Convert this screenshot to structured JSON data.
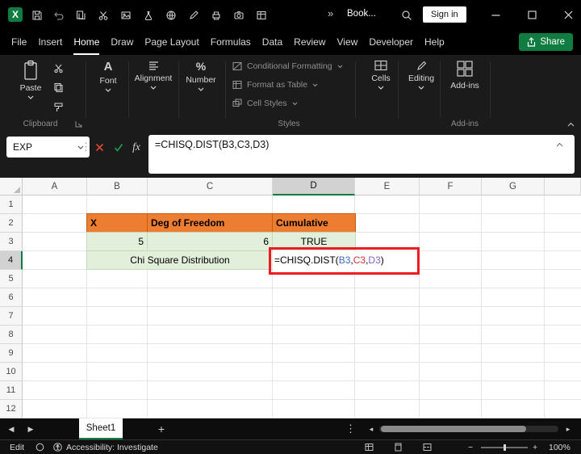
{
  "colors": {
    "excel_green": "#107C41",
    "titlebar_bg": "#000000",
    "ribbon_bg": "#1b1b1b",
    "orange_fill": "#ED7D31",
    "green_fill": "#E2EFDA",
    "annotation_red": "#EC1C24",
    "ref1_color": "#3B6EC5",
    "ref2_color": "#D13438",
    "ref3_color": "#8661C5"
  },
  "titlebar": {
    "doc_title": "Book...",
    "sign_in_label": "Sign in",
    "overflow_glyph": "»"
  },
  "menubar": {
    "tabs": [
      "File",
      "Insert",
      "Home",
      "Draw",
      "Page Layout",
      "Formulas",
      "Data",
      "Review",
      "View",
      "Developer",
      "Help"
    ],
    "active_tab": "Home",
    "share_label": "Share"
  },
  "ribbon": {
    "paste_label": "Paste",
    "font_label": "Font",
    "font_icon_glyph": "A",
    "alignment_label": "Alignment",
    "number_label": "Number",
    "number_icon_glyph": "%",
    "conditional_formatting_label": "Conditional Formatting",
    "format_as_table_label": "Format as Table",
    "cell_styles_label": "Cell Styles",
    "cells_label": "Cells",
    "editing_label": "Editing",
    "addins_label": "Add-ins",
    "group_clipboard_label": "Clipboard",
    "group_styles_label": "Styles",
    "group_addins_label": "Add-ins"
  },
  "formula_bar": {
    "name_box_value": "EXP",
    "menu_dots_glyph": "⋮",
    "fx_label": "fx",
    "formula_text": "=CHISQ.DIST(B3,C3,D3)"
  },
  "grid": {
    "column_headers": [
      "A",
      "B",
      "C",
      "D",
      "E",
      "F",
      "G"
    ],
    "row_headers": [
      "1",
      "2",
      "3",
      "4",
      "5",
      "6",
      "7",
      "8",
      "9",
      "10",
      "11",
      "12"
    ],
    "selected_column": "D",
    "selected_row": "4",
    "cells": {
      "b2": "X",
      "c2": "Deg of Freedom",
      "d2": "Cumulative",
      "b3": "5",
      "c3": "6",
      "d3": "TRUE",
      "b4_c4_merged": "Chi Square Distribution"
    },
    "d4_formula_parts": {
      "prefix": "=CHISQ.DIST(",
      "ref1": "B3",
      "sep1": ",",
      "ref2": "C3",
      "sep2": ",",
      "ref3": "D3",
      "suffix": ")"
    }
  },
  "sheet_bar": {
    "active_tab": "Sheet1",
    "nav_left_glyph": "◀",
    "nav_right_glyph": "▶",
    "add_sheet_glyph": "+",
    "menu_dots_glyph": "⋮",
    "scroll_left_glyph": "◂",
    "scroll_right_glyph": "▸"
  },
  "status_bar": {
    "mode_label": "Edit",
    "accessibility_label": "Accessibility: Investigate",
    "zoom_out_glyph": "−",
    "zoom_in_glyph": "+",
    "zoom_label": "100%"
  }
}
